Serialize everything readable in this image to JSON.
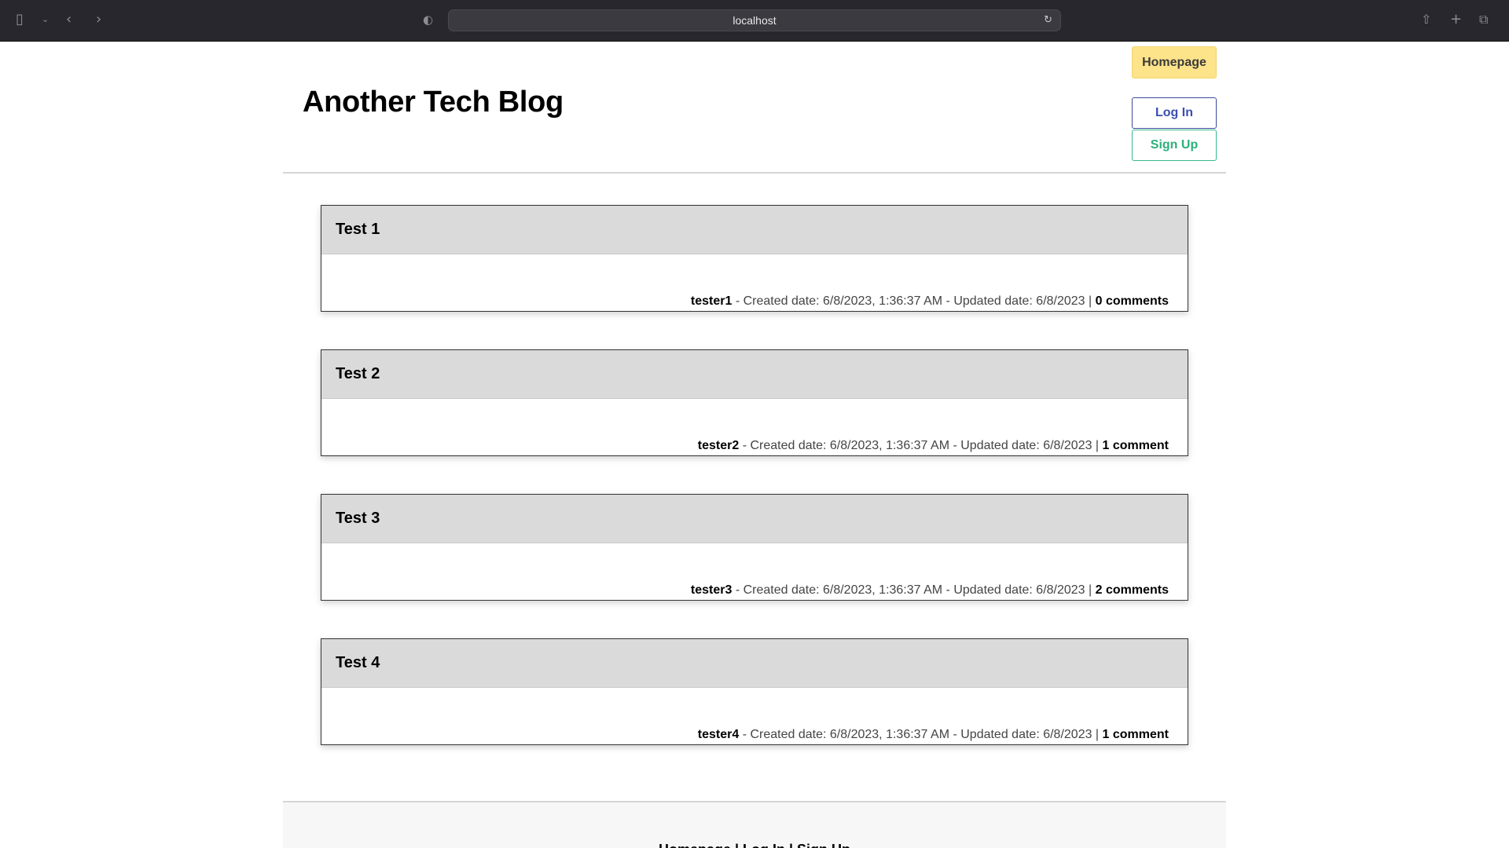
{
  "browser": {
    "url": "localhost",
    "icons": [
      "sidebar-icon",
      "chevron-down-icon",
      "back-icon",
      "forward-icon",
      "shield-icon",
      "reload-icon",
      "share-icon",
      "new-tab-icon",
      "tabs-icon"
    ]
  },
  "header": {
    "title": "Another Tech Blog",
    "homepage_label": "Homepage",
    "login_label": "Log In",
    "signup_label": "Sign Up"
  },
  "posts": [
    {
      "title": "Test 1",
      "author": "tester1",
      "created": " - Created date: 6/8/2023, 1:36:37 AM - Updated date: 6/8/2023 | ",
      "comments": "0 comments"
    },
    {
      "title": "Test 2",
      "author": "tester2",
      "created": " - Created date: 6/8/2023, 1:36:37 AM - Updated date: 6/8/2023 | ",
      "comments": "1 comment"
    },
    {
      "title": "Test 3",
      "author": "tester3",
      "created": " - Created date: 6/8/2023, 1:36:37 AM - Updated date: 6/8/2023 | ",
      "comments": "2 comments"
    },
    {
      "title": "Test 4",
      "author": "tester4",
      "created": " - Created date: 6/8/2023, 1:36:37 AM - Updated date: 6/8/2023 | ",
      "comments": "1 comment"
    }
  ],
  "footer": {
    "links_text": "Homepage | Log In | Sign Up"
  }
}
